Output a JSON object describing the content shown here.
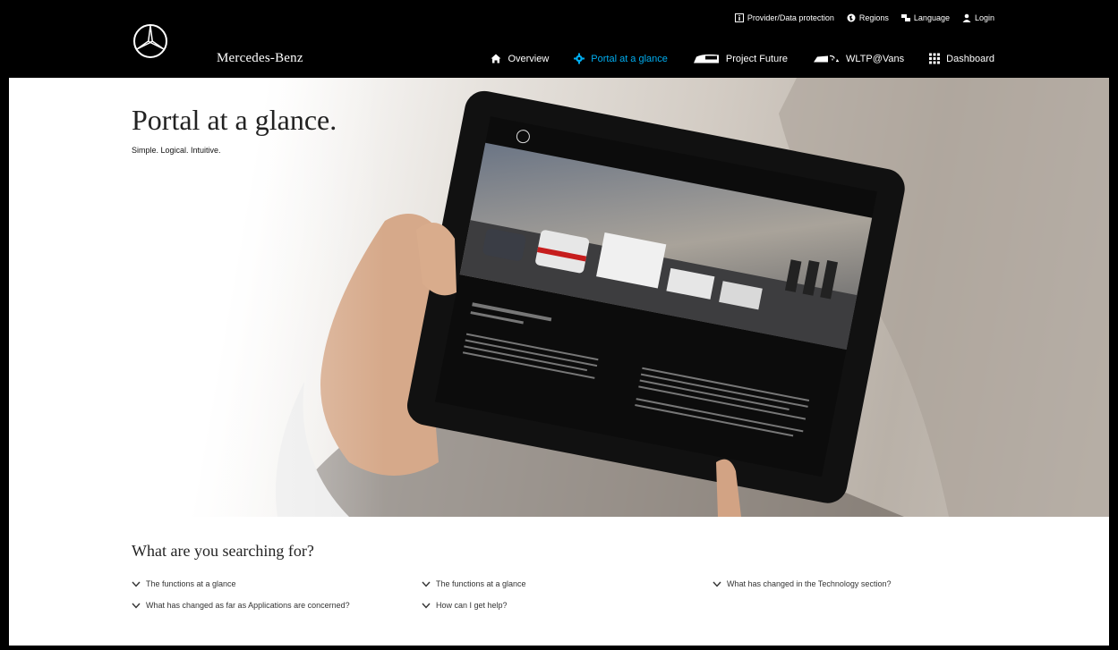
{
  "header": {
    "brand": "Mercedes-Benz",
    "utility_nav": [
      {
        "label": "Provider/Data protection",
        "icon": "info-icon"
      },
      {
        "label": "Regions",
        "icon": "globe-icon"
      },
      {
        "label": "Language",
        "icon": "language-icon"
      },
      {
        "label": "Login",
        "icon": "user-icon"
      }
    ],
    "main_nav": [
      {
        "label": "Overview",
        "icon": "home-icon",
        "active": false
      },
      {
        "label": "Portal at a glance",
        "icon": "gear-icon",
        "active": true
      },
      {
        "label": "Project Future",
        "icon": "van-icon",
        "active": false
      },
      {
        "label": "WLTP@Vans",
        "icon": "truck-icon",
        "active": false
      },
      {
        "label": "Dashboard",
        "icon": "grid-icon",
        "active": false
      }
    ],
    "active_color": "#00adef"
  },
  "hero": {
    "title": "Portal at a glance.",
    "subtitle": "Simple. Logical. Intuitive."
  },
  "faq": {
    "title": "What are you searching for?",
    "links": [
      "The functions at a glance",
      "The functions at a glance",
      "What has changed in the Technology section?",
      "What has changed as far as Applications are concerned?",
      "How can I get help?"
    ]
  }
}
